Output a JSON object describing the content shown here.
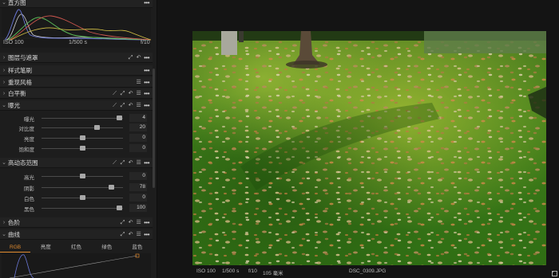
{
  "histogram": {
    "title": "直方图",
    "iso": "ISO 100",
    "shutter": "1/500 s",
    "aperture": "f/10"
  },
  "sections": {
    "layers": "图层与遮罩",
    "style": "样式笔刷",
    "reproduce": "重现风格",
    "white_balance": "白平衡",
    "exposure": "曝光",
    "hdr": "高动态范围",
    "levels": "色阶",
    "curve": "曲线"
  },
  "exposure_sliders": [
    {
      "label": "曝光",
      "value": "4"
    },
    {
      "label": "对比度",
      "value": "20"
    },
    {
      "label": "亮度",
      "value": "0"
    },
    {
      "label": "饱和度",
      "value": "0"
    }
  ],
  "hdr_sliders": [
    {
      "label": "高光",
      "value": "0"
    },
    {
      "label": "阴影",
      "value": "78"
    },
    {
      "label": "白色",
      "value": "0"
    },
    {
      "label": "黑色",
      "value": "100"
    }
  ],
  "curve_tabs": [
    "RGB",
    "亮度",
    "红色",
    "绿色",
    "蓝色"
  ],
  "status": {
    "iso": "ISO 100",
    "shutter": "1/500 s",
    "aperture": "f/10",
    "focal": "105 毫米",
    "filename": "DSC_0309.JPG"
  },
  "colors": {
    "accent": "#e08a2e",
    "panel": "#1d1d1d",
    "viewer": "#141414"
  }
}
